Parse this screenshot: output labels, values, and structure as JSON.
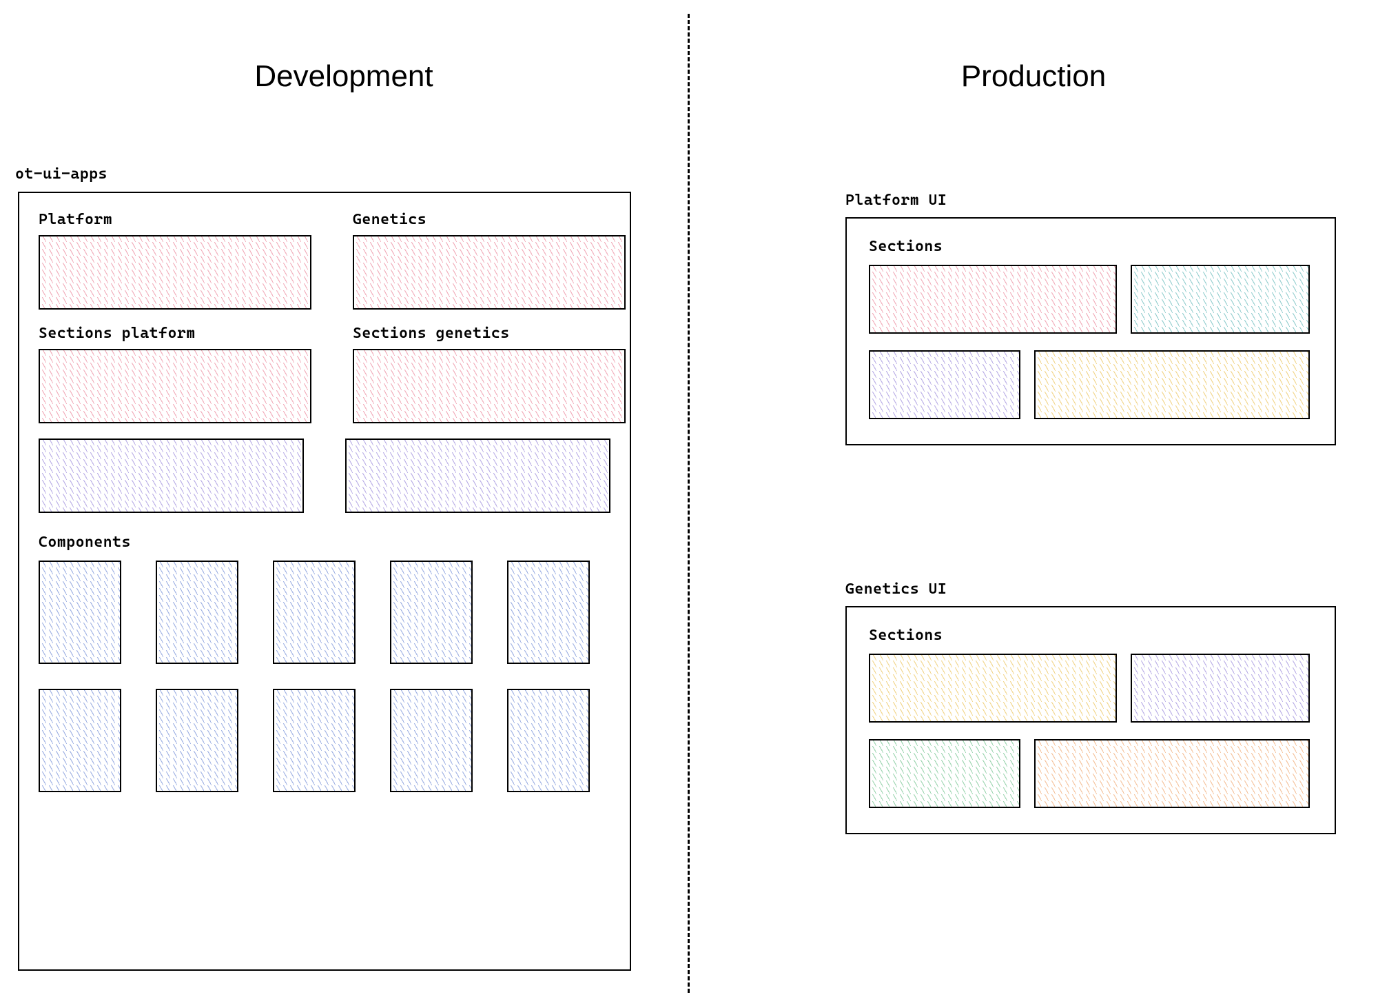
{
  "left": {
    "heading": "Development",
    "main_label": "ot-ui-apps",
    "row_a": {
      "platform_label": "Platform",
      "genetics_label": "Genetics",
      "sections_platform_label": "Sections platform",
      "sections_genetics_label": "Sections genetics"
    },
    "components_label": "Components"
  },
  "right": {
    "heading": "Production",
    "platform_ui_label": "Platform UI",
    "genetics_ui_label": "Genetics UI",
    "sections_label": "Sections"
  },
  "colors": {
    "pink": "#e35d78",
    "purple": "#7960ce",
    "blue": "#4367c9",
    "teal": "#30a1a2",
    "yellow": "#e8b530",
    "green": "#3faf67",
    "orange": "#eb883c"
  }
}
